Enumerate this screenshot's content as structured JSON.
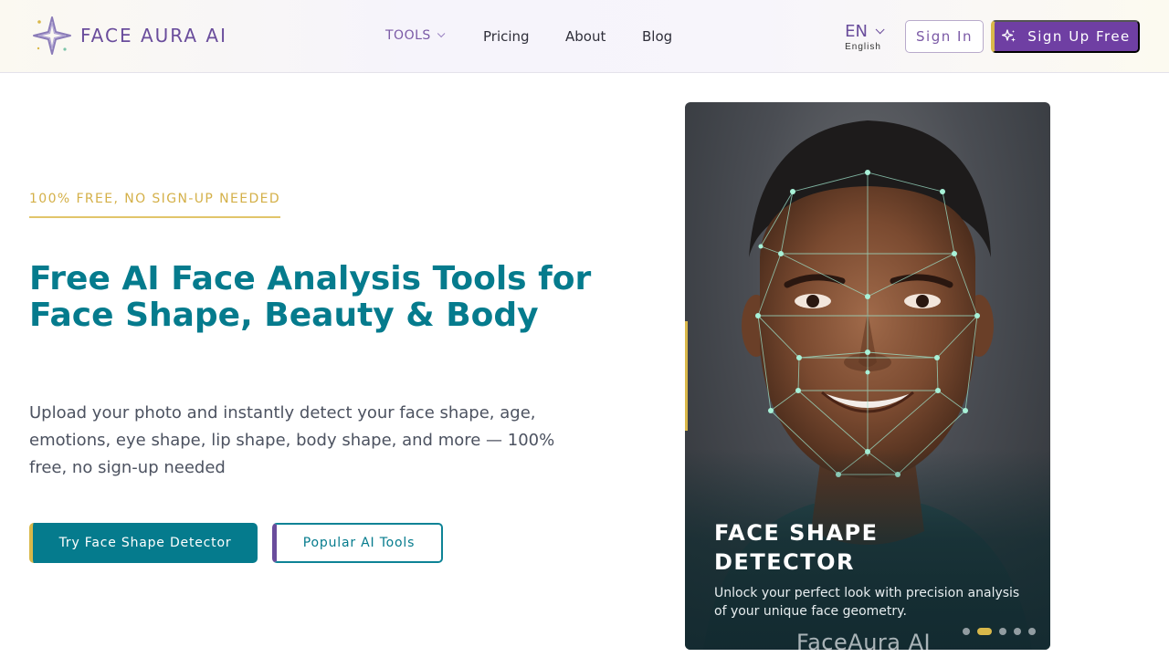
{
  "brand": {
    "name": "FACE AURA AI"
  },
  "nav": {
    "tools": "TOOLS",
    "pricing": "Pricing",
    "about": "About",
    "blog": "Blog"
  },
  "lang": {
    "code": "EN",
    "name": "English"
  },
  "auth": {
    "sign_in": "Sign In",
    "sign_up": "Sign Up Free"
  },
  "hero": {
    "eyebrow": "100% FREE, NO SIGN-UP NEEDED",
    "title": "Free AI Face Analysis Tools for Face Shape, Beauty & Body",
    "description": "Upload your photo and instantly detect your face shape, age, emotions, eye shape, lip shape, body shape, and more — 100% free, no sign-up needed",
    "primary_cta": "Try Face Shape Detector",
    "secondary_cta": "Popular AI Tools"
  },
  "carousel": {
    "slide_title": "FACE SHAPE DETECTOR",
    "slide_description": "Unlock your perfect look with precision analysis of your unique face geometry.",
    "watermark": "FaceAura AI",
    "slide_count": 5,
    "active_index": 1
  },
  "colors": {
    "primary_teal": "#057b8d",
    "brand_purple": "#6f3fa3",
    "accent_gold": "#d9b84a"
  },
  "icons": {
    "logo": "four-point-star-logo-icon",
    "tools_chevron": "chevron-down-icon",
    "lang_chevron": "chevron-down-icon",
    "signup": "sparkles-icon"
  }
}
